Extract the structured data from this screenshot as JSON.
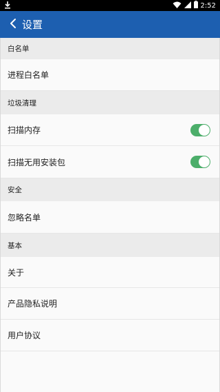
{
  "status_bar": {
    "time": "2:52",
    "icons": [
      "download-icon",
      "wifi-icon",
      "cell-signal-icon",
      "battery-icon"
    ]
  },
  "app_bar": {
    "back_icon": "chevron-left-icon",
    "title": "设置"
  },
  "sections": [
    {
      "header": "白名单",
      "items": [
        {
          "label": "进程白名单"
        }
      ]
    },
    {
      "header": "垃圾清理",
      "items": [
        {
          "label": "扫描内存",
          "toggle": true
        },
        {
          "label": "扫描无用安装包",
          "toggle": true
        }
      ]
    },
    {
      "header": "安全",
      "items": [
        {
          "label": "忽略名单"
        }
      ]
    },
    {
      "header": "基本",
      "items": [
        {
          "label": "关于"
        },
        {
          "label": "产品隐私说明"
        },
        {
          "label": "用户协议"
        }
      ]
    }
  ],
  "colors": {
    "app_bar": "#1d5fb0",
    "toggle_on": "#4cae6a",
    "section_bg": "#ebebeb"
  }
}
